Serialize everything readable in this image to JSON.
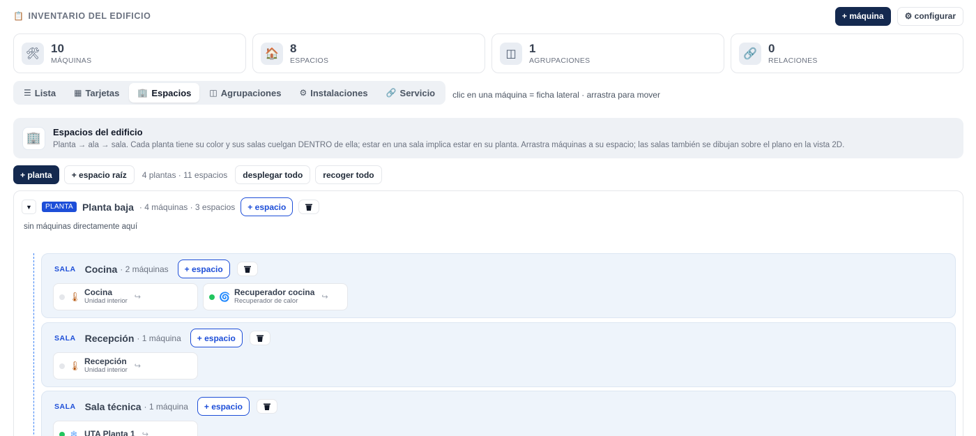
{
  "header": {
    "title": "INVENTARIO DEL EDIFICIO",
    "icon": "clipboard-icon",
    "add_machine_label": "+ máquina",
    "configure_label": "⚙ configurar"
  },
  "stats": [
    {
      "value": "10",
      "label": "MÁQUINAS",
      "icon": "tools-icon"
    },
    {
      "value": "8",
      "label": "ESPACIOS",
      "icon": "house-icon"
    },
    {
      "value": "1",
      "label": "AGRUPACIONES",
      "icon": "columns-icon"
    },
    {
      "value": "0",
      "label": "RELACIONES",
      "icon": "link-icon"
    }
  ],
  "tabs": [
    {
      "label": "Lista",
      "icon": "☰"
    },
    {
      "label": "Tarjetas",
      "icon": "▦"
    },
    {
      "label": "Espacios",
      "icon": "🏢"
    },
    {
      "label": "Agrupaciones",
      "icon": "◫"
    },
    {
      "label": "Instalaciones",
      "icon": "⚙"
    },
    {
      "label": "Servicio",
      "icon": "🔗"
    }
  ],
  "active_tab": "Espacios",
  "hint": "clic en una máquina = ficha lateral · arrastra para mover",
  "banner": {
    "title": "Espacios del edificio",
    "description": "Planta → ala → sala. Cada planta tiene su color y sus salas cuelgan DENTRO de ella; estar en una sala implica estar en su planta. Arrastra máquinas a su espacio; las salas también se dibujan sobre el plano en la vista 2D."
  },
  "actions": {
    "add_floor": "+ planta",
    "add_root_space": "+ espacio raíz",
    "summary": "4 plantas · 11 espacios",
    "expand_all": "desplegar todo",
    "collapse_all": "recoger todo"
  },
  "floor": {
    "badge": "PLANTA",
    "name": "Planta baja",
    "meta": "· 4 máquinas · 3 espacios",
    "add_space": "+ espacio",
    "toggle": "▼",
    "empty_note": "sin máquinas directamente aquí",
    "rooms": [
      {
        "badge": "SALA",
        "name": "Cocina",
        "meta": "· 2 máquinas",
        "add_space": "+ espacio",
        "machines": [
          {
            "name": "Cocina",
            "type": "Unidad interior",
            "status": "off",
            "icon": "thermometer-icon"
          },
          {
            "name": "Recuperador cocina",
            "type": "Recuperador de calor",
            "status": "on",
            "icon": "fan-icon"
          }
        ]
      },
      {
        "badge": "SALA",
        "name": "Recepción",
        "meta": "· 1 máquina",
        "add_space": "+ espacio",
        "machines": [
          {
            "name": "Recepción",
            "type": "Unidad interior",
            "status": "off",
            "icon": "thermometer-icon"
          }
        ]
      },
      {
        "badge": "SALA",
        "name": "Sala técnica",
        "meta": "· 1 máquina",
        "add_space": "+ espacio",
        "machines": [
          {
            "name": "UTA Planta 1",
            "type": "",
            "status": "on",
            "icon": "air-handler-icon"
          }
        ]
      }
    ]
  }
}
